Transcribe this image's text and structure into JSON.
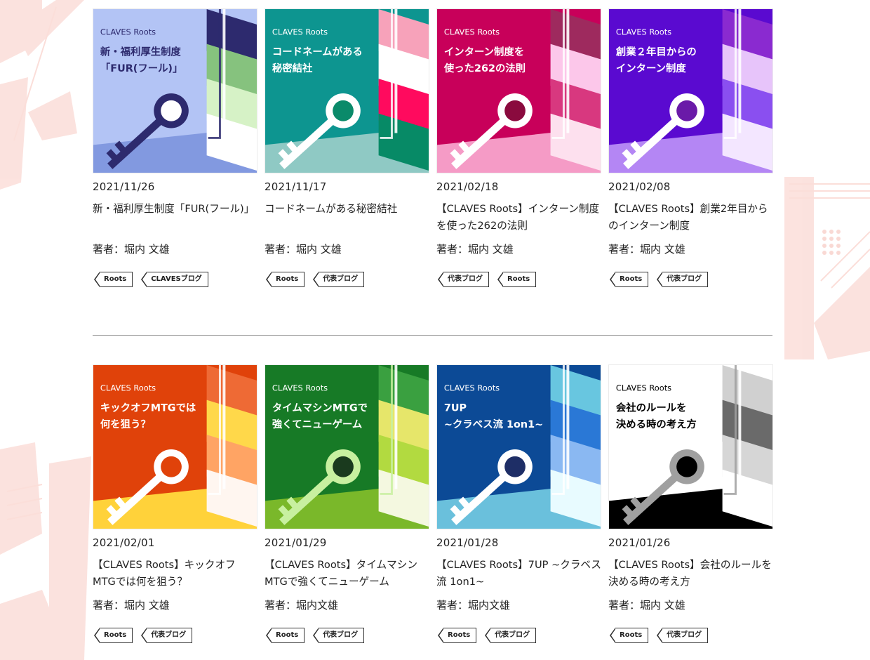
{
  "thumb_common": {
    "brand": "CLAVES Roots"
  },
  "divider_color": "#999999",
  "background_decoration_color": "#f7c9c2",
  "articles": [
    {
      "date": "2021/11/26",
      "title": "新・福利厚生制度「FUR(フール)」",
      "author": "著者：堀内 文雄",
      "tags": [
        "Roots",
        "CLAVESブログ"
      ],
      "thumb": {
        "line1": "新・福利厚生制度",
        "line2": "「FUR(フール)」",
        "bg": "#b3c4f5",
        "floor": "#8299e0",
        "stripes": [
          "#2d2a6e",
          "#86c27e",
          "#d6f2c6",
          "#ffffff"
        ],
        "key": "#2d2a6e",
        "key_hole": "#ffffff",
        "text_color": "#2d2a6e"
      }
    },
    {
      "date": "2021/11/17",
      "title": "コードネームがある秘密結社",
      "author": "著者：堀内 文雄",
      "tags": [
        "Roots",
        "代表ブログ"
      ],
      "thumb": {
        "line1": "コードネームがある",
        "line2": "秘密結社",
        "bg": "#0d9590",
        "floor": "#8fc9c4",
        "stripes": [
          "#f7a2ba",
          "#ffffff",
          "#ff0a5e",
          "#078a66"
        ],
        "key": "#ffffff",
        "key_hole": "#0a8a6a",
        "text_color": "#ffffff"
      }
    },
    {
      "date": "2021/02/18",
      "title": "【CLAVES Roots】インターン制度を使った262の法則",
      "author": "著者：堀内 文雄",
      "tags": [
        "代表ブログ",
        "Roots"
      ],
      "thumb": {
        "line1": "インターン制度を",
        "line2": "使った262の法則",
        "bg": "#c8005a",
        "floor": "#f59bc6",
        "stripes": [
          "#9e2a5e",
          "#fcc7ea",
          "#d8387f",
          "#fde0ee"
        ],
        "key": "#ffffff",
        "key_hole": "#8a0a3e",
        "text_color": "#ffffff"
      }
    },
    {
      "date": "2021/02/08",
      "title": "【CLAVES Roots】創業2年目からのインターン制度",
      "author": "著者：堀内 文雄",
      "tags": [
        "Roots",
        "代表ブログ"
      ],
      "thumb": {
        "line1": "創業２年目からの",
        "line2": "インターン制度",
        "bg": "#5a0ad0",
        "floor": "#b486f4",
        "stripes": [
          "#8a2ad0",
          "#e7c4fa",
          "#8a4ff0",
          "#f3e6ff"
        ],
        "key": "#ffffff",
        "key_hole": "#6a1aa8",
        "text_color": "#ffffff"
      }
    },
    {
      "date": "2021/02/01",
      "title": "【CLAVES Roots】キックオフMTGでは何を狙う？",
      "author": "著者：堀内 文雄",
      "tags": [
        "Roots",
        "代表ブログ"
      ],
      "thumb": {
        "line1": "キックオフMTGでは",
        "line2": "何を狙う？",
        "bg": "#e0420a",
        "floor": "#ffd23a",
        "stripes": [
          "#ee6a35",
          "#ffd84a",
          "#ffa464",
          "#fff6f0"
        ],
        "key": "#ffffff",
        "key_hole": "#e0420a",
        "text_color": "#ffffff"
      }
    },
    {
      "date": "2021/01/29",
      "title": "【CLAVES Roots】タイムマシンMTGで強くてニューゲーム",
      "author": "著者：堀内文雄",
      "tags": [
        "Roots",
        "代表ブログ"
      ],
      "thumb": {
        "line1": "タイムマシンMTGで",
        "line2": "強くてニューゲーム",
        "bg": "#177a26",
        "floor": "#7ab82a",
        "stripes": [
          "#3aa040",
          "#e6e66a",
          "#b2da40",
          "#f4f8e0"
        ],
        "key": "#c8f0a0",
        "key_hole": "#1a3a1e",
        "text_color": "#ffffff"
      }
    },
    {
      "date": "2021/01/28",
      "title": "【CLAVES Roots】7UP ~クラベス流 1on1~",
      "author": "著者：堀内文雄",
      "tags": [
        "Roots",
        "代表ブログ"
      ],
      "thumb": {
        "line1": "7UP",
        "line2": "~クラベス流 1on1~",
        "bg": "#0c4a96",
        "floor": "#6ac0dc",
        "stripes": [
          "#68c6e0",
          "#2a78d6",
          "#8ab8f2",
          "#e8fbff"
        ],
        "key": "#ffffff",
        "key_hole": "#1e2e66",
        "text_color": "#ffffff"
      }
    },
    {
      "date": "2021/01/26",
      "title": "【CLAVES Roots】会社のルールを決める時の考え方",
      "author": "著者：堀内 文雄",
      "tags": [
        "Roots",
        "代表ブログ"
      ],
      "thumb": {
        "line1": "会社のルールを",
        "line2": "決める時の考え方",
        "bg": "#ffffff",
        "floor": "#000000",
        "stripes": [
          "#d0d0d0",
          "#6a6a6a",
          "#d6d6d6",
          "#ffffff"
        ],
        "key": "#a0a0a0",
        "key_hole": "#000000",
        "text_color": "#000000"
      }
    }
  ]
}
